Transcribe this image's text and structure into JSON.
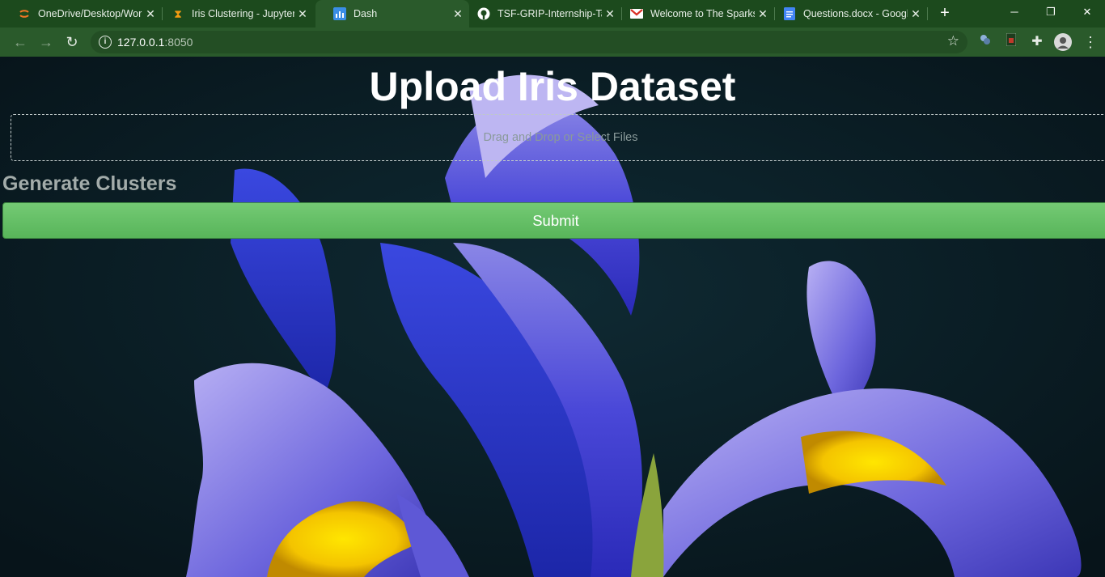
{
  "browser": {
    "tabs": [
      {
        "label": "OneDrive/Desktop/Wor",
        "icon": "jupyter-icon"
      },
      {
        "label": "Iris Clustering - Jupyter",
        "icon": "hourglass-icon"
      },
      {
        "label": "Dash",
        "icon": "dash-icon",
        "active": true
      },
      {
        "label": "TSF-GRIP-Internship-Ta",
        "icon": "github-icon"
      },
      {
        "label": "Welcome to The Sparks",
        "icon": "gmail-icon"
      },
      {
        "label": "Questions.docx - Googl",
        "icon": "docs-icon"
      }
    ],
    "address": {
      "host": "127.0.0.1",
      "port": ":8050"
    },
    "colors": {
      "frame": "#1c4a1d",
      "toolbar": "#2a5a2b"
    }
  },
  "page": {
    "title": "Upload Iris Dataset",
    "upload_text": "Drag and Drop or Select Files",
    "section_heading": "Generate Clusters",
    "submit_label": "Submit",
    "colors": {
      "submit": "#5cb85c",
      "background": "#0b1b22"
    }
  }
}
